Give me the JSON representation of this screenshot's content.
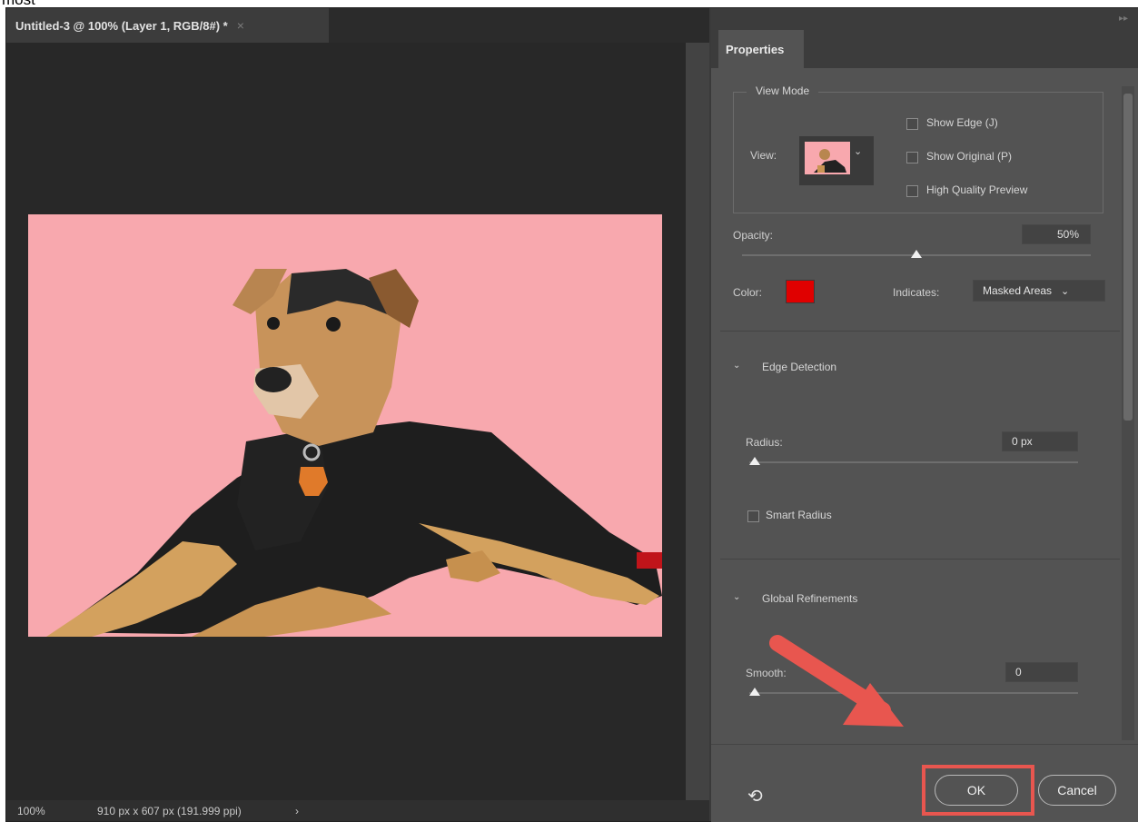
{
  "caption_fragment": "most",
  "document": {
    "tab_title": "Untitled-3 @ 100% (Layer 1, RGB/8#) *",
    "tab_close": "×",
    "status_zoom": "100%",
    "status_dims": "910 px x 607 px (191.999 ppi)",
    "status_arrow": "›"
  },
  "properties": {
    "tab_label": "Properties",
    "view_mode": {
      "legend": "View Mode",
      "view_label": "View:",
      "show_edge": "Show Edge (J)",
      "show_original": "Show Original (P)",
      "high_quality": "High Quality Preview"
    },
    "opacity_label": "Opacity:",
    "opacity_value": "50%",
    "opacity_level": 0.5,
    "color_label": "Color:",
    "mask_color": "#e00000",
    "indicates_label": "Indicates:",
    "indicates_value": "Masked Areas",
    "edge_detection": {
      "title": "Edge Detection",
      "radius_label": "Radius:",
      "radius_value": "0 px",
      "smart_radius": "Smart Radius"
    },
    "global_refinements": {
      "title": "Global Refinements",
      "smooth_label": "Smooth:",
      "smooth_value": "0"
    },
    "footer": {
      "ok": "OK",
      "cancel": "Cancel"
    }
  },
  "colors": {
    "highlight": "#e8564f",
    "canvas_bg": "#f8a8ae"
  }
}
